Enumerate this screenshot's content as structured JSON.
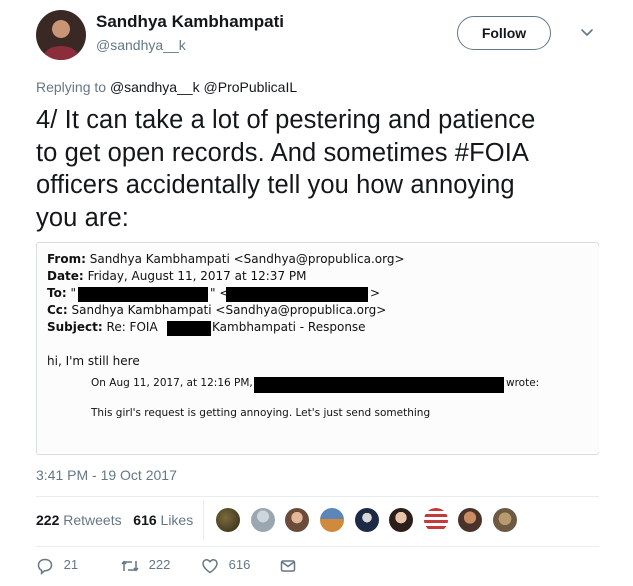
{
  "user": {
    "name": "Sandhya Kambhampati",
    "handle": "@sandhya__k"
  },
  "follow_label": "Follow",
  "reply": {
    "prefix": "Replying to",
    "to1": "@sandhya__k",
    "to2": "@ProPublicaIL"
  },
  "tweet": {
    "line1": "4/ It can take a lot of pestering and patience",
    "line2": "to get open records. And sometimes #FOIA",
    "line3": "officers accidentally tell you how annoying",
    "line4": "you are:"
  },
  "email": {
    "from_label": "From:",
    "from_value": "Sandhya Kambhampati <Sandhya@propublica.org>",
    "date_label": "Date:",
    "date_value": "Friday, August 11, 2017 at 12:37 PM",
    "to_label": "To:",
    "to_q1": "\"",
    "to_q2": "\" <",
    "to_end": ">",
    "cc_label": "Cc:",
    "cc_value": "Sandhya Kambhampati <Sandhya@propublica.org>",
    "subject_label": "Subject:",
    "subject_a": "Re: FOIA",
    "subject_b": "Kambhampati - Response",
    "body1": "hi, I'm still here",
    "quote_prefix": "On Aug 11, 2017, at 12:16 PM,",
    "quote_suffix": "wrote:",
    "quote_body": "This girl's request is getting annoying. Let's just send something"
  },
  "timestamp": "3:41 PM - 19 Oct 2017",
  "stats": {
    "retweets_count": "222",
    "retweets_label": "Retweets",
    "likes_count": "616",
    "likes_label": "Likes"
  },
  "actions": {
    "replies": "21",
    "retweets": "222",
    "likes": "616"
  },
  "colors": {
    "link": "#1b95e0",
    "muted": "#657786",
    "text": "#14171a"
  }
}
